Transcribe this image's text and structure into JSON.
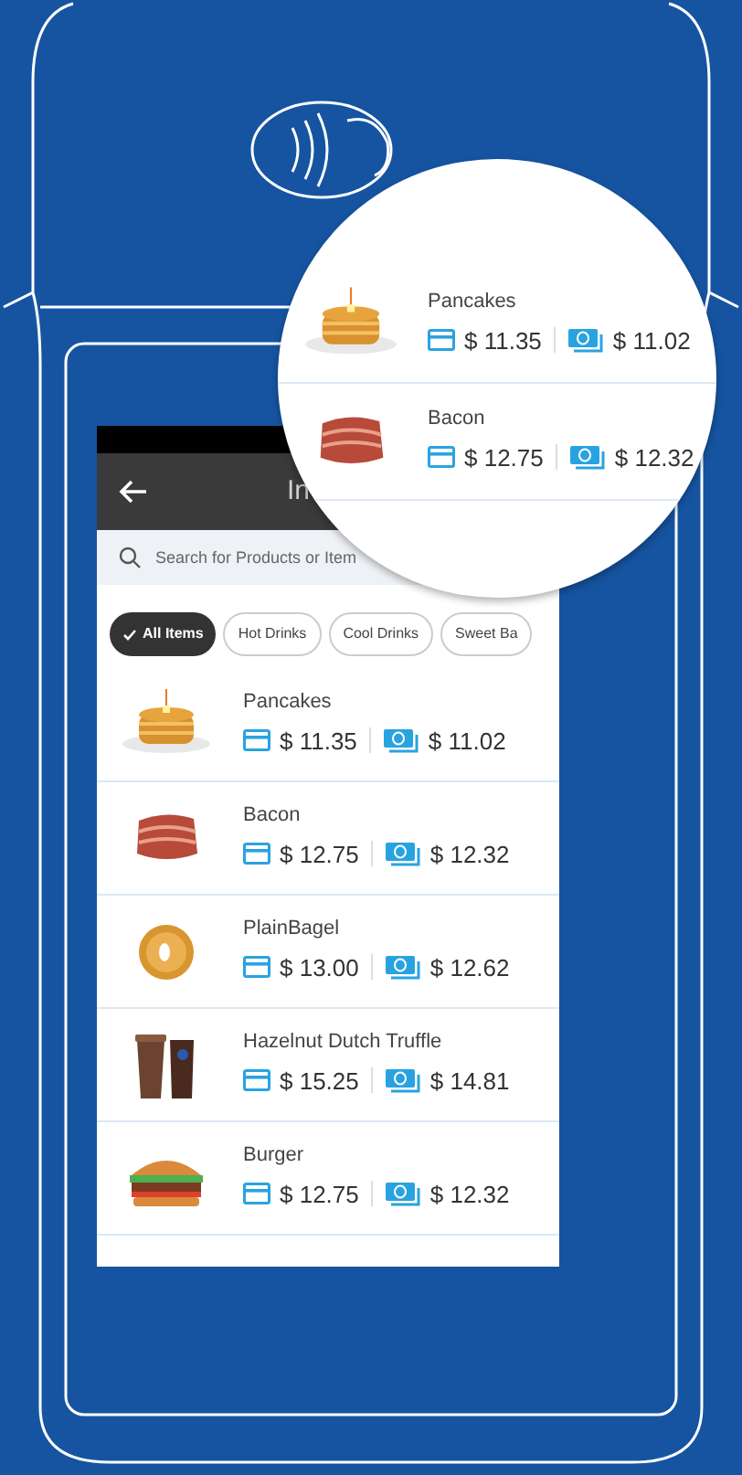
{
  "header": {
    "title": "In"
  },
  "search": {
    "placeholder": "Search for Products or Item"
  },
  "chips": [
    {
      "label": "All Items",
      "selected": true
    },
    {
      "label": "Hot Drinks",
      "selected": false
    },
    {
      "label": "Cool Drinks",
      "selected": false
    },
    {
      "label": "Sweet Ba",
      "selected": false
    }
  ],
  "items": [
    {
      "name": "Pancakes",
      "card_price": "$ 11.35",
      "cash_price": "$ 11.02",
      "image": {
        "kind": "pancakes"
      }
    },
    {
      "name": "Bacon",
      "card_price": "$ 12.75",
      "cash_price": "$ 12.32",
      "image": {
        "kind": "bacon"
      }
    },
    {
      "name": "PlainBagel",
      "card_price": "$ 13.00",
      "cash_price": "$ 12.62",
      "image": {
        "kind": "bagel"
      }
    },
    {
      "name": "Hazelnut Dutch Truffle",
      "card_price": "$ 15.25",
      "cash_price": "$ 14.81",
      "image": {
        "kind": "drinks"
      }
    },
    {
      "name": "Burger",
      "card_price": "$ 12.75",
      "cash_price": "$ 12.32",
      "image": {
        "kind": "burger"
      }
    }
  ],
  "magnifier": {
    "items": [
      {
        "name": "Pancakes",
        "card_price": "$ 11.35",
        "cash_price": "$ 11.02",
        "image": {
          "kind": "pancakes"
        }
      },
      {
        "name": "Bacon",
        "card_price": "$ 12.75",
        "cash_price": "$ 12.32",
        "image": {
          "kind": "bacon"
        }
      }
    ]
  }
}
